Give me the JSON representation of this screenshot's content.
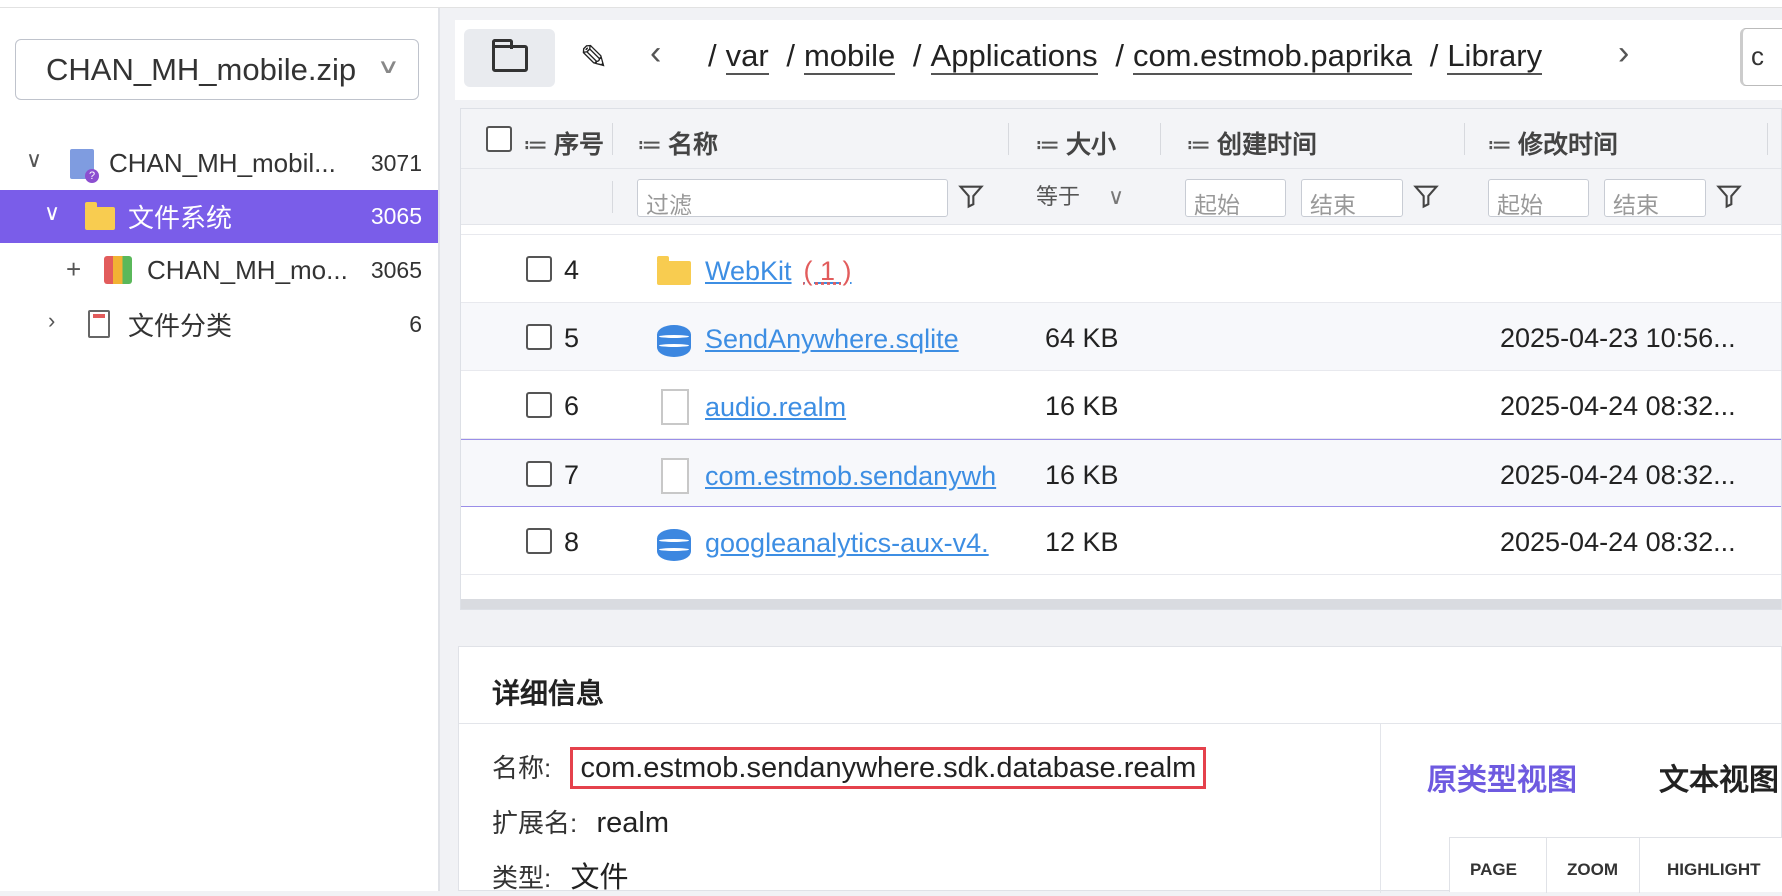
{
  "left_panel": {
    "case_select": "CHAN_MH_mobile.zip",
    "tree": [
      {
        "label": "CHAN_MH_mobil...",
        "count": "3071"
      },
      {
        "label": "文件系统",
        "count": "3065"
      },
      {
        "label": "CHAN_MH_mo...",
        "count": "3065"
      },
      {
        "label": "文件分类",
        "count": "6"
      }
    ]
  },
  "toolbar": {
    "breadcrumbs": [
      "var",
      "mobile",
      "Applications",
      "com.estmob.paprika",
      "Library"
    ],
    "search_value": "c"
  },
  "grid": {
    "columns": {
      "index": "序号",
      "name": "名称",
      "size": "大小",
      "created": "创建时间",
      "modified": "修改时间"
    },
    "filters": {
      "name_placeholder": "过滤",
      "size_op": "等于",
      "start": "起始",
      "end": "结束"
    },
    "rows": [
      {
        "num": "4",
        "name": "WebKit",
        "type": "folder",
        "child_count": "( 1 )",
        "size": "",
        "mtime": ""
      },
      {
        "num": "5",
        "name": "SendAnywhere.sqlite",
        "type": "database",
        "size": "64 KB",
        "mtime": "2025-04-23 10:56..."
      },
      {
        "num": "6",
        "name": "audio.realm",
        "type": "file",
        "size": "16 KB",
        "mtime": "2025-04-24 08:32..."
      },
      {
        "num": "7",
        "name": "com.estmob.sendanywh",
        "type": "file",
        "size": "16 KB",
        "mtime": "2025-04-24 08:32..."
      },
      {
        "num": "8",
        "name": "googleanalytics-aux-v4.",
        "type": "database",
        "size": "12 KB",
        "mtime": "2025-04-24 08:32..."
      }
    ]
  },
  "details": {
    "title": "详细信息",
    "name_label": "名称:",
    "name_value": "com.estmob.sendanywhere.sdk.database.realm",
    "ext_label": "扩展名:",
    "ext_value": "realm",
    "type_label": "类型:",
    "type_value": "文件",
    "tabs": [
      "原类型视图",
      "文本视图"
    ],
    "viewer_toolbar": [
      "PAGE",
      "ZOOM",
      "HIGHLIGHT"
    ]
  },
  "colors": {
    "accent": "#7a5de9",
    "link": "#3d8ee3",
    "highlight_border": "#e5414c"
  }
}
